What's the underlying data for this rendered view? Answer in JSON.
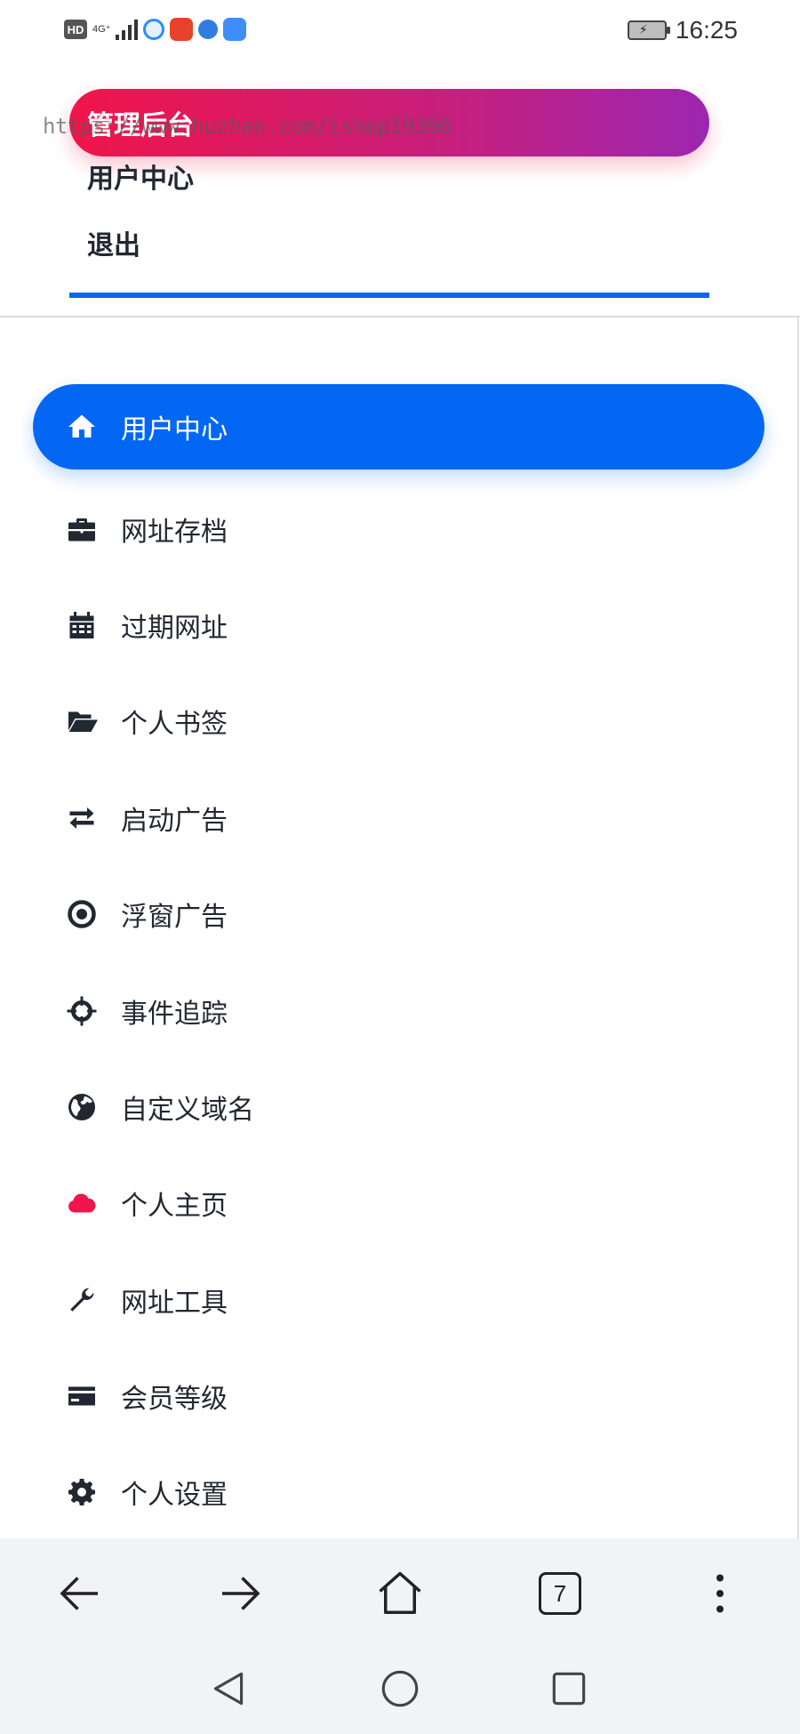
{
  "status_bar": {
    "hd_label": "HD",
    "network_label": "4G⁺",
    "time": "16:25"
  },
  "top_menu": {
    "admin_label": "管理后台",
    "user_center_label": "用户中心",
    "logout_label": "退出"
  },
  "watermark": "https://www.huzhan.com/ishop19396",
  "sidebar": {
    "items": [
      {
        "label": "用户中心",
        "icon": "home-icon",
        "active": true
      },
      {
        "label": "网址存档",
        "icon": "briefcase-icon"
      },
      {
        "label": "过期网址",
        "icon": "calendar-icon"
      },
      {
        "label": "个人书签",
        "icon": "folder-open-icon"
      },
      {
        "label": "启动广告",
        "icon": "exchange-arrows-icon"
      },
      {
        "label": "浮窗广告",
        "icon": "dot-circle-icon"
      },
      {
        "label": "事件追踪",
        "icon": "crosshairs-icon"
      },
      {
        "label": "自定义域名",
        "icon": "globe-icon"
      },
      {
        "label": "个人主页",
        "icon": "cloud-icon",
        "icon_color": "#f0154a"
      },
      {
        "label": "网址工具",
        "icon": "wrench-icon"
      },
      {
        "label": "会员等级",
        "icon": "credit-card-icon"
      },
      {
        "label": "个人设置",
        "icon": "gear-icon"
      }
    ]
  },
  "browser_bar": {
    "tab_count": "7"
  },
  "colors": {
    "accent_blue": "#0367f3",
    "gradient_start": "#f0154a",
    "gradient_end": "#9c27b0",
    "text_dark": "#222831"
  }
}
